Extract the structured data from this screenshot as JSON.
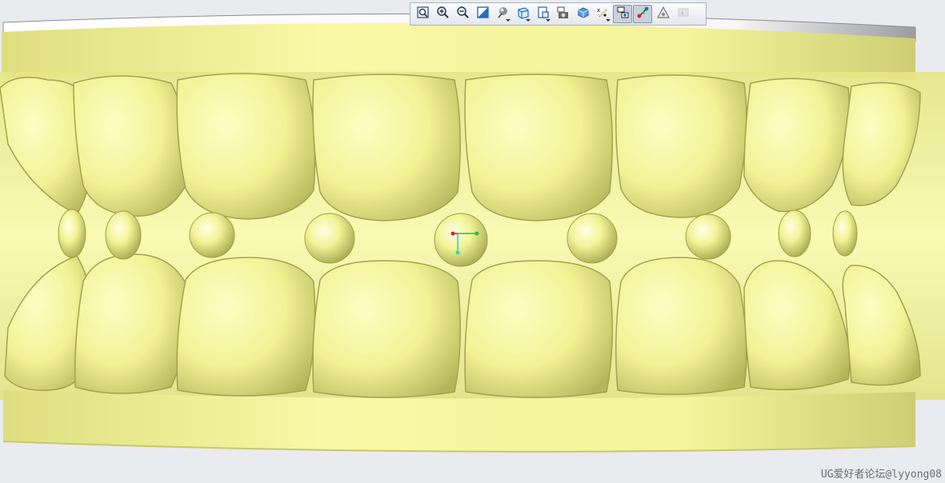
{
  "toolbar": {
    "buttons": [
      {
        "icon": "fit-view-icon",
        "has_dropdown": false,
        "active": false,
        "disabled": false
      },
      {
        "icon": "zoom-in-icon",
        "has_dropdown": false,
        "active": false,
        "disabled": false
      },
      {
        "icon": "zoom-out-icon",
        "has_dropdown": false,
        "active": false,
        "disabled": false
      },
      {
        "icon": "zoom-window-icon",
        "has_dropdown": false,
        "active": false,
        "disabled": false
      },
      {
        "icon": "rendering-style-icon",
        "has_dropdown": true,
        "active": false,
        "disabled": false
      },
      {
        "icon": "orient-view-icon",
        "has_dropdown": true,
        "active": false,
        "disabled": false
      },
      {
        "icon": "view-layout-icon",
        "has_dropdown": true,
        "active": false,
        "disabled": false
      },
      {
        "icon": "capture-image-icon",
        "has_dropdown": false,
        "active": false,
        "disabled": false
      },
      {
        "icon": "view-section-icon",
        "has_dropdown": false,
        "active": false,
        "disabled": false
      },
      {
        "icon": "snap-point-icon",
        "has_dropdown": true,
        "active": false,
        "disabled": false
      },
      {
        "icon": "show-hide-icon",
        "has_dropdown": false,
        "active": true,
        "disabled": false
      },
      {
        "icon": "datum-triad-icon",
        "has_dropdown": false,
        "active": true,
        "disabled": false
      },
      {
        "icon": "measure-icon",
        "has_dropdown": false,
        "active": false,
        "disabled": false
      },
      {
        "icon": "undo-view-icon",
        "has_dropdown": false,
        "active": false,
        "disabled": true
      }
    ]
  },
  "watermark": "UG爱好者论坛@lyyong08",
  "colors": {
    "model": "#f5f59a",
    "model_shadow": "#b8b85a",
    "model_dark": "#9e9e48",
    "background": "#e9ebee",
    "triad_x": "#e0202a",
    "triad_y": "#23c23a",
    "triad_z": "#21d7cf"
  }
}
